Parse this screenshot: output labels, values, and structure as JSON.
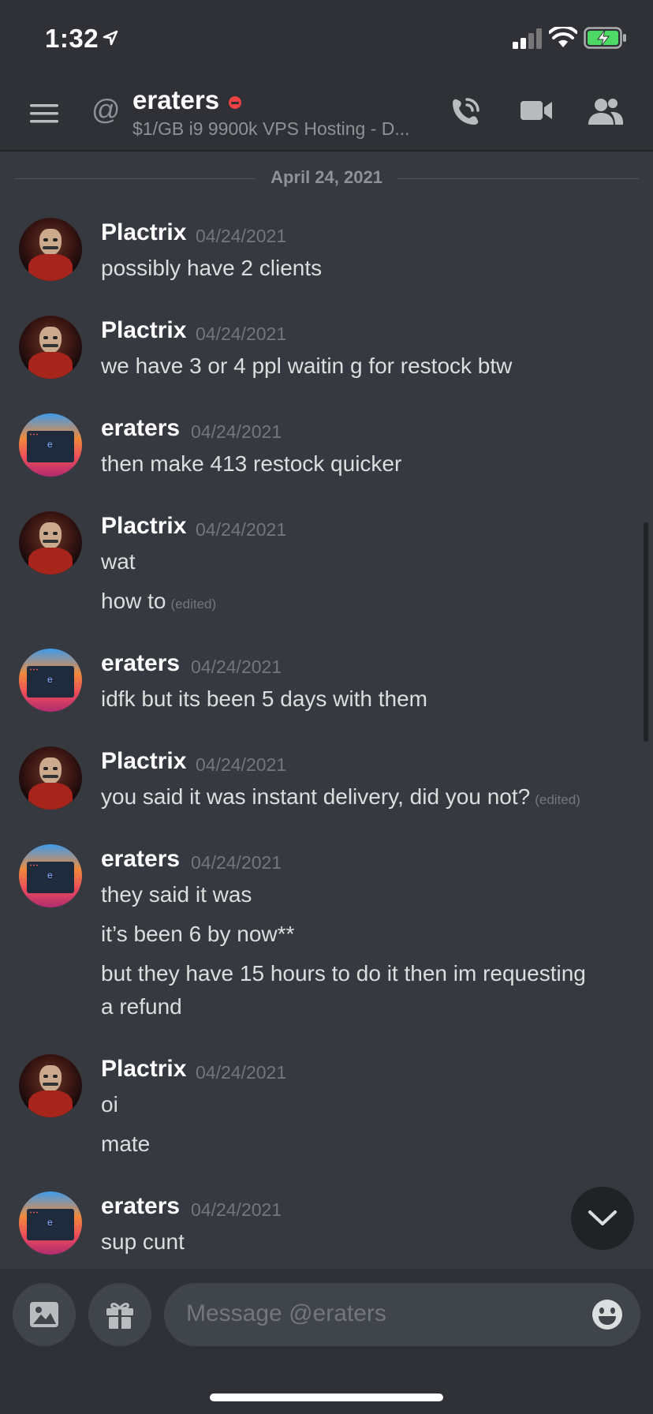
{
  "status": {
    "time": "1:32"
  },
  "header": {
    "title": "eraters",
    "subtitle": "$1/GB i9 9900k VPS Hosting - D..."
  },
  "date_divider": "April 24, 2021",
  "messages": [
    {
      "author": "Plactrix",
      "avatar": "plactrix-avatar",
      "timestamp": "04/24/2021",
      "lines": [
        "possibly have 2 clients"
      ]
    },
    {
      "author": "Plactrix",
      "avatar": "plactrix-avatar",
      "timestamp": "04/24/2021",
      "lines": [
        "we have 3 or 4 ppl waitin g for restock btw"
      ]
    },
    {
      "author": "eraters",
      "avatar": "eraters-avatar",
      "timestamp": "04/24/2021",
      "lines": [
        "then make 413 restock quicker"
      ]
    },
    {
      "author": "Plactrix",
      "avatar": "plactrix-avatar",
      "timestamp": "04/24/2021",
      "lines": [
        "wat",
        "how to"
      ],
      "edited_label": "(edited)"
    },
    {
      "author": "eraters",
      "avatar": "eraters-avatar",
      "timestamp": "04/24/2021",
      "lines": [
        "idfk but its been 5 days with them"
      ]
    },
    {
      "author": "Plactrix",
      "avatar": "plactrix-avatar",
      "timestamp": "04/24/2021",
      "lines": [
        "you said it was instant delivery, did you not?"
      ],
      "edited_label": "(edited)"
    },
    {
      "author": "eraters",
      "avatar": "eraters-avatar",
      "timestamp": "04/24/2021",
      "lines": [
        "they said it was",
        "it’s been 6 by now**",
        "but they have 15 hours to do it then im requesting",
        "a refund"
      ]
    },
    {
      "author": "Plactrix",
      "avatar": "plactrix-avatar",
      "timestamp": "04/24/2021",
      "lines": [
        "oi",
        "mate"
      ]
    },
    {
      "author": "eraters",
      "avatar": "eraters-avatar",
      "timestamp": "04/24/2021",
      "lines": [
        "sup cunt"
      ]
    }
  ],
  "composer": {
    "placeholder": "Message @eraters"
  },
  "icons": {
    "menu": "hamburger-menu-icon",
    "at": "at-sign-icon",
    "call": "phone-call-icon",
    "video": "video-camera-icon",
    "members": "members-icon",
    "image": "image-upload-icon",
    "gift": "gift-icon",
    "emoji": "emoji-icon",
    "jump": "chevron-down-icon"
  },
  "colors": {
    "background": "#36393f",
    "header": "#2f3136",
    "dnd": "#ed4245"
  }
}
